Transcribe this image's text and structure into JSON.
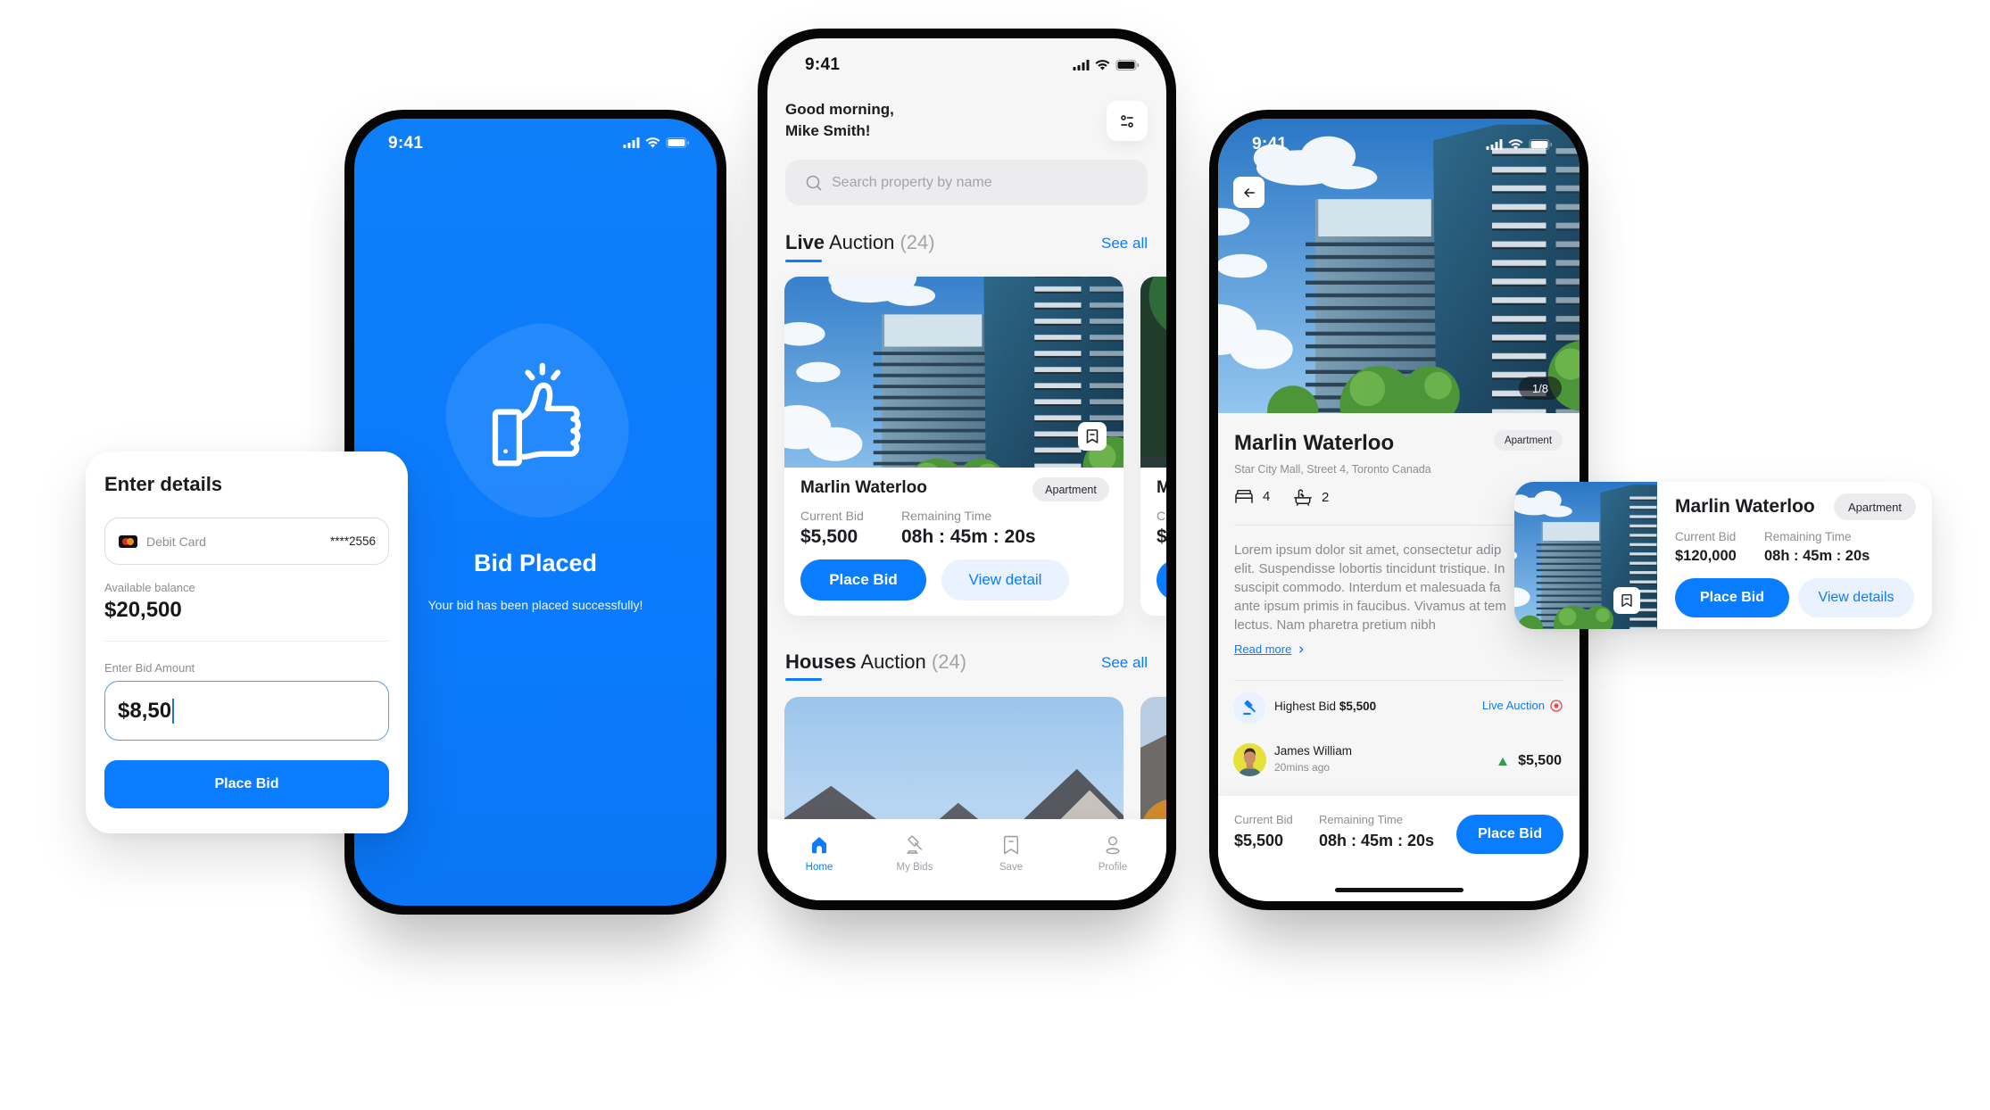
{
  "theme": {
    "primary": "#0a7cff",
    "primary_soft": "#eaf2ff",
    "text": "#1c1c21",
    "muted": "#8d8d94",
    "live_red": "#ef4444",
    "trend_up": "#22a447"
  },
  "bid_form": {
    "title": "Enter details",
    "payment_method": {
      "icon": "mastercard-icon",
      "label": "Debit Card",
      "masked_number": "****2556"
    },
    "balance_label": "Available balance",
    "balance_value": "$20,500",
    "amount_label": "Enter Bid Amount",
    "amount_value": "$8,50",
    "submit_label": "Place Bid"
  },
  "bid_placed": {
    "status_time": "9:41",
    "icon": "thumbs-up-icon",
    "title": "Bid Placed",
    "message": "Your bid has been placed successfully!"
  },
  "home": {
    "status_time": "9:41",
    "greeting_line1": "Good morning,",
    "greeting_line2": "Mike Smith!",
    "filter_icon": "filter-icon",
    "search": {
      "icon": "search-icon",
      "placeholder": "Search property by name",
      "value": ""
    },
    "live_auction": {
      "title_bold": "Live",
      "title_rest": "Auction",
      "count": "(24)",
      "see_all": "See all"
    },
    "live_card": {
      "name": "Marlin Waterloo",
      "type": "Apartment",
      "current_bid_label": "Current Bid",
      "current_bid": "$5,500",
      "remaining_label": "Remaining Time",
      "remaining": "08h : 45m : 20s",
      "place_bid": "Place Bid",
      "view_detail": "View detail"
    },
    "live_card_peek": {
      "name": "M",
      "label": "C",
      "value": "$"
    },
    "houses_auction": {
      "title_bold": "Houses",
      "title_rest": "Auction",
      "count": "(24)",
      "see_all": "See all"
    },
    "nav": [
      {
        "label": "Home",
        "icon": "home-icon",
        "active": true
      },
      {
        "label": "My Bids",
        "icon": "gavel-icon",
        "active": false
      },
      {
        "label": "Save",
        "icon": "bookmark-icon",
        "active": false
      },
      {
        "label": "Profile",
        "icon": "profile-icon",
        "active": false
      }
    ]
  },
  "detail": {
    "status_time": "9:41",
    "photo_counter": "1/8",
    "name": "Marlin Waterloo",
    "type": "Apartment",
    "address": "Star City Mall, Street 4, Toronto Canada",
    "bedrooms": "4",
    "bathrooms": "2",
    "description_lines": [
      "Lorem ipsum dolor sit amet, consectetur adip",
      "elit. Suspendisse lobortis tincidunt tristique. In",
      "suscipit commodo. Interdum et malesuada fa",
      "ante ipsum primis in faucibus. Vivamus at tem",
      "lectus. Nam pharetra pretium nibh"
    ],
    "read_more": "Read more",
    "highest_bid_label": "Highest Bid",
    "highest_bid_value": "$5,500",
    "live_badge": "Live Auction",
    "bids": [
      {
        "bidder": "James William",
        "time": "20mins ago",
        "amount": "$5,500",
        "trend": "up"
      }
    ],
    "footer": {
      "current_bid_label": "Current Bid",
      "current_bid": "$5,500",
      "remaining_label": "Remaining Time",
      "remaining": "08h : 45m : 20s",
      "place_bid": "Place Bid"
    }
  },
  "floating_card": {
    "name": "Marlin Waterloo",
    "type": "Apartment",
    "current_bid_label": "Current Bid",
    "current_bid": "$120,000",
    "remaining_label": "Remaining Time",
    "remaining": "08h : 45m : 20s",
    "place_bid": "Place Bid",
    "view_details": "View details"
  }
}
